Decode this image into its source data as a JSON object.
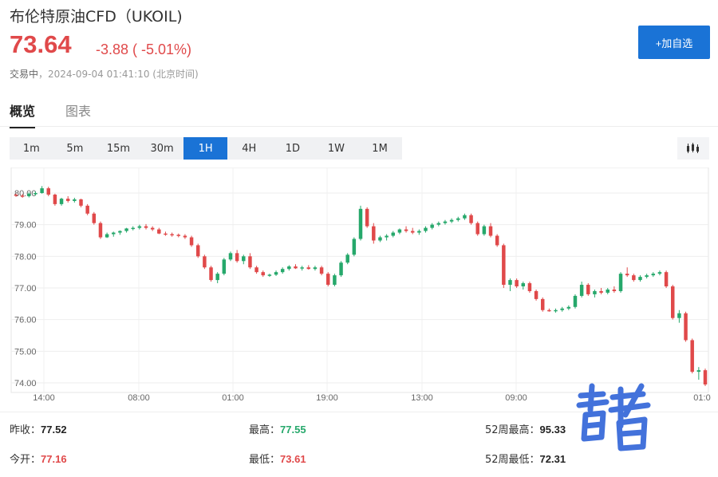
{
  "header": {
    "title": "布伦特原油CFD（UKOIL)",
    "price": "73.64",
    "change": "-3.88 ( -5.01%)",
    "status": "交易中",
    "timestamp": "，2024-09-04 01:41:10 (北京时间)",
    "watch_label": "+加自选"
  },
  "tabs": [
    {
      "label": "概览",
      "active": true
    },
    {
      "label": "图表",
      "active": false
    }
  ],
  "intervals": [
    "1m",
    "5m",
    "15m",
    "30m",
    "1H",
    "4H",
    "1D",
    "1W",
    "1M"
  ],
  "active_interval": "1H",
  "colors": {
    "up": "#26a86b",
    "down": "#e0494a",
    "accent": "#1a73d6"
  },
  "chart_data": {
    "type": "candlestick",
    "y_ticks": [
      "80.00",
      "79.00",
      "78.00",
      "77.00",
      "76.00",
      "75.00",
      "74.00"
    ],
    "x_ticks": [
      "14:00",
      "08:00",
      "01:00",
      "19:00",
      "13:00",
      "09:00",
      "01:0"
    ],
    "ylim": [
      73.9,
      80.2
    ],
    "grid": true,
    "candles": [
      [
        79.95,
        79.98,
        79.88,
        79.92
      ],
      [
        79.92,
        79.97,
        79.85,
        79.9
      ],
      [
        79.9,
        80.02,
        79.86,
        79.98
      ],
      [
        79.98,
        80.05,
        79.92,
        80.0
      ],
      [
        80.0,
        80.22,
        79.98,
        80.15
      ],
      [
        80.15,
        80.2,
        79.9,
        79.95
      ],
      [
        79.95,
        79.98,
        79.6,
        79.65
      ],
      [
        79.65,
        79.85,
        79.6,
        79.82
      ],
      [
        79.82,
        79.9,
        79.7,
        79.75
      ],
      [
        79.75,
        79.85,
        79.7,
        79.8
      ],
      [
        79.8,
        79.82,
        79.55,
        79.6
      ],
      [
        79.6,
        79.65,
        79.3,
        79.35
      ],
      [
        79.35,
        79.4,
        79.0,
        79.05
      ],
      [
        79.05,
        79.1,
        78.55,
        78.6
      ],
      [
        78.6,
        78.75,
        78.58,
        78.7
      ],
      [
        78.7,
        78.78,
        78.62,
        78.75
      ],
      [
        78.75,
        78.82,
        78.68,
        78.8
      ],
      [
        78.8,
        78.9,
        78.75,
        78.88
      ],
      [
        78.88,
        78.95,
        78.82,
        78.9
      ],
      [
        78.9,
        79.0,
        78.85,
        78.95
      ],
      [
        78.95,
        79.02,
        78.85,
        78.9
      ],
      [
        78.9,
        78.95,
        78.8,
        78.85
      ],
      [
        78.85,
        78.9,
        78.7,
        78.72
      ],
      [
        78.72,
        78.78,
        78.65,
        78.7
      ],
      [
        78.7,
        78.75,
        78.62,
        78.68
      ],
      [
        78.68,
        78.72,
        78.6,
        78.65
      ],
      [
        78.65,
        78.7,
        78.55,
        78.6
      ],
      [
        78.6,
        78.65,
        78.3,
        78.35
      ],
      [
        78.35,
        78.4,
        77.95,
        78.0
      ],
      [
        78.0,
        78.05,
        77.6,
        77.65
      ],
      [
        77.65,
        77.7,
        77.2,
        77.25
      ],
      [
        77.25,
        77.5,
        77.15,
        77.45
      ],
      [
        77.45,
        77.95,
        77.4,
        77.9
      ],
      [
        77.9,
        78.15,
        77.85,
        78.1
      ],
      [
        78.1,
        78.2,
        77.8,
        77.85
      ],
      [
        77.85,
        78.05,
        77.75,
        78.0
      ],
      [
        78.0,
        78.1,
        77.6,
        77.65
      ],
      [
        77.65,
        77.7,
        77.45,
        77.5
      ],
      [
        77.5,
        77.55,
        77.35,
        77.4
      ],
      [
        77.4,
        77.45,
        77.35,
        77.42
      ],
      [
        77.42,
        77.55,
        77.38,
        77.5
      ],
      [
        77.5,
        77.65,
        77.45,
        77.6
      ],
      [
        77.6,
        77.72,
        77.55,
        77.68
      ],
      [
        77.68,
        77.75,
        77.6,
        77.62
      ],
      [
        77.62,
        77.7,
        77.55,
        77.65
      ],
      [
        77.65,
        77.72,
        77.58,
        77.6
      ],
      [
        77.6,
        77.7,
        77.55,
        77.65
      ],
      [
        77.65,
        77.7,
        77.4,
        77.45
      ],
      [
        77.45,
        77.5,
        77.05,
        77.1
      ],
      [
        77.1,
        77.45,
        77.05,
        77.4
      ],
      [
        77.4,
        77.85,
        77.35,
        77.8
      ],
      [
        77.8,
        78.1,
        77.75,
        78.05
      ],
      [
        78.05,
        78.6,
        78.0,
        78.55
      ],
      [
        78.55,
        79.6,
        78.5,
        79.5
      ],
      [
        79.5,
        79.55,
        78.9,
        78.95
      ],
      [
        78.95,
        79.05,
        78.4,
        78.5
      ],
      [
        78.5,
        78.65,
        78.45,
        78.6
      ],
      [
        78.6,
        78.7,
        78.5,
        78.65
      ],
      [
        78.65,
        78.8,
        78.6,
        78.75
      ],
      [
        78.75,
        78.88,
        78.7,
        78.85
      ],
      [
        78.85,
        78.95,
        78.75,
        78.8
      ],
      [
        78.8,
        78.9,
        78.7,
        78.75
      ],
      [
        78.75,
        78.85,
        78.68,
        78.8
      ],
      [
        78.8,
        78.95,
        78.75,
        78.9
      ],
      [
        78.9,
        79.05,
        78.85,
        79.0
      ],
      [
        79.0,
        79.1,
        78.95,
        79.05
      ],
      [
        79.05,
        79.15,
        79.0,
        79.1
      ],
      [
        79.1,
        79.2,
        79.05,
        79.15
      ],
      [
        79.15,
        79.25,
        79.1,
        79.2
      ],
      [
        79.2,
        79.35,
        79.15,
        79.3
      ],
      [
        79.3,
        79.35,
        79.0,
        79.05
      ],
      [
        79.05,
        79.1,
        78.65,
        78.7
      ],
      [
        78.7,
        79.0,
        78.65,
        78.95
      ],
      [
        78.95,
        79.05,
        78.6,
        78.65
      ],
      [
        78.65,
        78.7,
        78.3,
        78.35
      ],
      [
        78.35,
        78.4,
        77.0,
        77.1
      ],
      [
        77.1,
        77.3,
        76.9,
        77.25
      ],
      [
        77.25,
        77.3,
        77.0,
        77.05
      ],
      [
        77.05,
        77.2,
        76.95,
        77.15
      ],
      [
        77.15,
        77.2,
        76.85,
        76.9
      ],
      [
        76.9,
        76.95,
        76.6,
        76.65
      ],
      [
        76.65,
        76.7,
        76.25,
        76.3
      ],
      [
        76.3,
        76.35,
        76.25,
        76.28
      ],
      [
        76.28,
        76.35,
        76.22,
        76.3
      ],
      [
        76.3,
        76.4,
        76.25,
        76.35
      ],
      [
        76.35,
        76.45,
        76.3,
        76.4
      ],
      [
        76.4,
        76.8,
        76.35,
        76.75
      ],
      [
        76.75,
        77.2,
        76.7,
        77.1
      ],
      [
        77.1,
        77.15,
        76.75,
        76.8
      ],
      [
        76.8,
        76.95,
        76.7,
        76.9
      ],
      [
        76.9,
        77.0,
        76.8,
        76.85
      ],
      [
        76.85,
        77.0,
        76.8,
        76.95
      ],
      [
        76.95,
        77.05,
        76.85,
        76.9
      ],
      [
        76.9,
        77.5,
        76.85,
        77.45
      ],
      [
        77.45,
        77.65,
        77.35,
        77.4
      ],
      [
        77.4,
        77.45,
        77.2,
        77.25
      ],
      [
        77.25,
        77.4,
        77.2,
        77.35
      ],
      [
        77.35,
        77.45,
        77.3,
        77.4
      ],
      [
        77.4,
        77.5,
        77.35,
        77.45
      ],
      [
        77.45,
        77.55,
        77.4,
        77.5
      ],
      [
        77.5,
        77.55,
        77.0,
        77.05
      ],
      [
        77.05,
        77.1,
        76.0,
        76.05
      ],
      [
        76.05,
        76.3,
        75.9,
        76.2
      ],
      [
        76.2,
        76.25,
        75.3,
        75.35
      ],
      [
        75.35,
        75.4,
        74.3,
        74.35
      ],
      [
        74.35,
        74.5,
        74.1,
        74.4
      ],
      [
        74.4,
        74.45,
        73.9,
        73.95
      ]
    ]
  },
  "stats": {
    "prev_close_label": "昨收：",
    "prev_close": "77.52",
    "high_label": "最高：",
    "high": "77.55",
    "high52_label": "52周最高：",
    "high52": "95.33",
    "open_label": "今开：",
    "open": "77.16",
    "low_label": "最低：",
    "low": "73.61",
    "low52_label": "52周最低：",
    "low52": "72.31"
  }
}
